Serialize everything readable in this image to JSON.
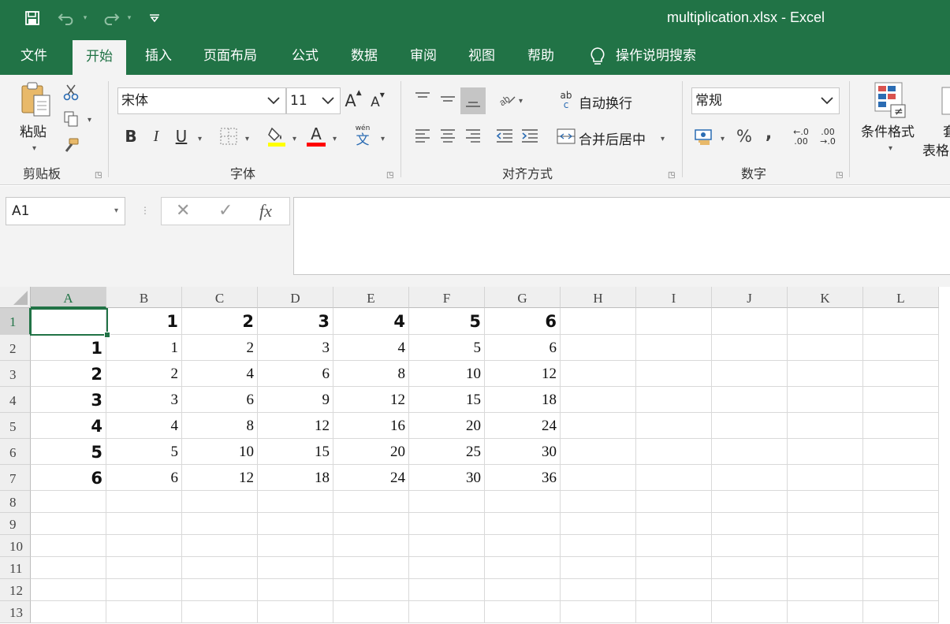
{
  "window": {
    "title": "multiplication.xlsx  -  Excel"
  },
  "quick_access": {
    "save_icon": "save-icon",
    "undo_icon": "undo-icon",
    "redo_icon": "redo-icon",
    "customize_icon": "customize-icon"
  },
  "tabs": [
    {
      "label": "文件",
      "active": false
    },
    {
      "label": "开始",
      "active": true
    },
    {
      "label": "插入",
      "active": false
    },
    {
      "label": "页面布局",
      "active": false
    },
    {
      "label": "公式",
      "active": false
    },
    {
      "label": "数据",
      "active": false
    },
    {
      "label": "审阅",
      "active": false
    },
    {
      "label": "视图",
      "active": false
    },
    {
      "label": "帮助",
      "active": false
    }
  ],
  "tell_me": {
    "label": "操作说明搜索"
  },
  "ribbon": {
    "clipboard": {
      "paste_label": "粘贴",
      "group_label": "剪贴板"
    },
    "font": {
      "font_name": "宋体",
      "font_size": "11",
      "group_label": "字体",
      "bold": "B",
      "italic": "I",
      "underline": "U",
      "grow": "A",
      "shrink": "A",
      "phonetic_top": "wén",
      "phonetic_bottom": "文",
      "font_color": "A"
    },
    "alignment": {
      "wrap_text": "自动换行",
      "merge_center": "合并后居中",
      "group_label": "对齐方式",
      "wrap_icon_top": "ab",
      "wrap_icon_bottom": "c"
    },
    "number": {
      "format": "常规",
      "group_label": "数字",
      "percent": "%",
      "comma": ",",
      "inc_decimal_top": "←.0",
      "inc_decimal_bottom": ".00",
      "dec_decimal_top": ".00",
      "dec_decimal_bottom": "→.0"
    },
    "styles": {
      "conditional_format": "条件格式",
      "table_format_top": "套",
      "table_format_bottom": "表格"
    }
  },
  "formula_bar": {
    "name_box": "A1",
    "formula": "",
    "fx": "fx",
    "cancel": "✕",
    "confirm": "✓"
  },
  "sheet": {
    "selected_cell": "A1",
    "columns": [
      "A",
      "B",
      "C",
      "D",
      "E",
      "F",
      "G",
      "H",
      "I",
      "J",
      "K",
      "L"
    ],
    "rows": [
      "1",
      "2",
      "3",
      "4",
      "5",
      "6",
      "7",
      "8",
      "9",
      "10",
      "11",
      "12",
      "13"
    ],
    "cells": [
      [
        "",
        "1",
        "2",
        "3",
        "4",
        "5",
        "6"
      ],
      [
        "1",
        "1",
        "2",
        "3",
        "4",
        "5",
        "6"
      ],
      [
        "2",
        "2",
        "4",
        "6",
        "8",
        "10",
        "12"
      ],
      [
        "3",
        "3",
        "6",
        "9",
        "12",
        "15",
        "18"
      ],
      [
        "4",
        "4",
        "8",
        "12",
        "16",
        "20",
        "24"
      ],
      [
        "5",
        "5",
        "10",
        "15",
        "20",
        "25",
        "30"
      ],
      [
        "6",
        "6",
        "12",
        "18",
        "24",
        "30",
        "36"
      ]
    ]
  },
  "colors": {
    "accent": "#217346",
    "ribbon_bg": "#f3f3f3",
    "fill_yellow": "#ffff00",
    "font_red": "#ff0000"
  }
}
